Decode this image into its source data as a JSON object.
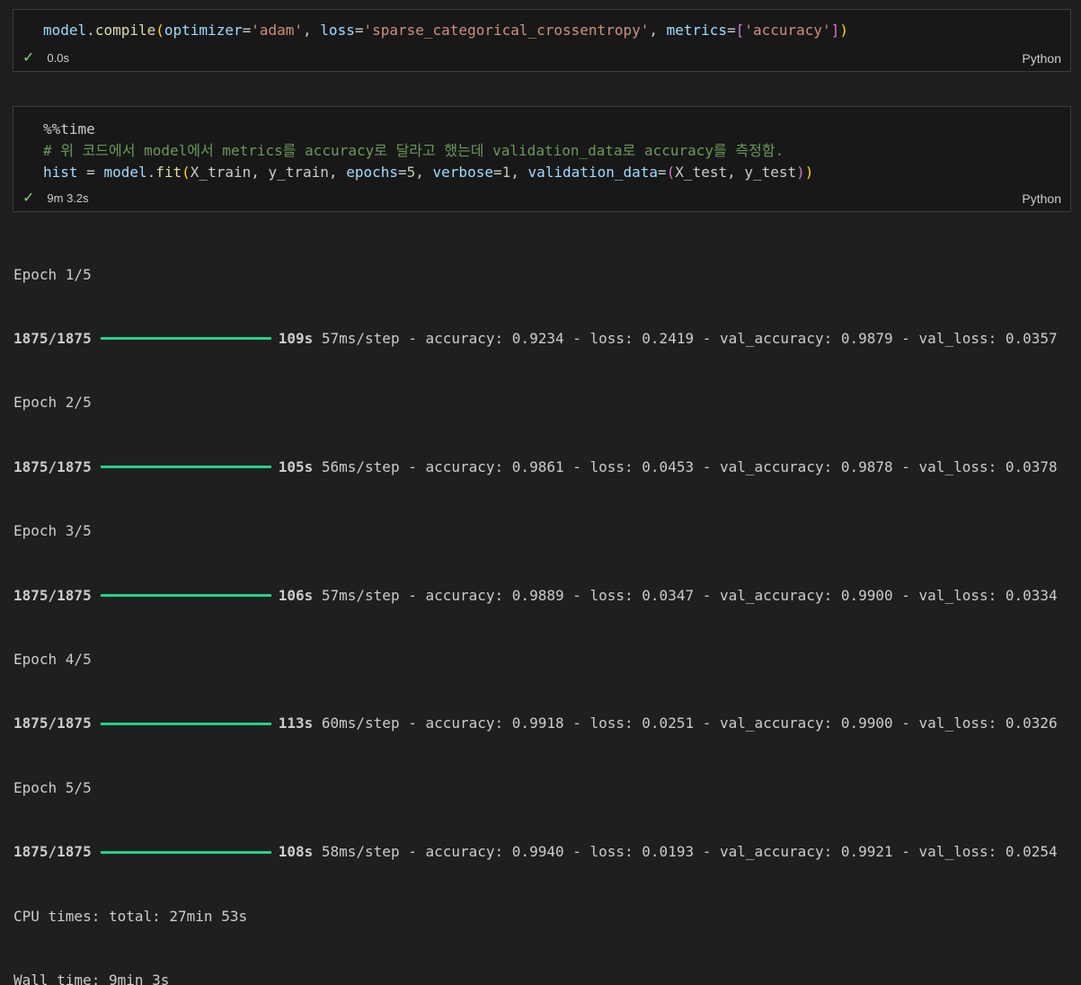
{
  "cell1": {
    "tokens": {
      "model": "model",
      "dot": ".",
      "compile": "compile",
      "open": "(",
      "optimizer": "optimizer",
      "eq1": "=",
      "adam": "'adam'",
      "comma1": ", ",
      "loss": "loss",
      "eq2": "=",
      "loss_val": "'sparse_categorical_crossentropy'",
      "comma2": ", ",
      "metrics": "metrics",
      "eq3": "=",
      "lb": "[",
      "acc": "'accuracy'",
      "rb": "]",
      "close": ")"
    },
    "time": "0.0s",
    "language": "Python"
  },
  "cell2": {
    "line1": "%%time",
    "line2": "# 위 코드에서 model에서 metrics를 accuracy로 달라고 했는데 validation_data로 accuracy를 측정함.",
    "tokens": {
      "hist": "hist",
      "assign": " = ",
      "model": "model",
      "dot": ".",
      "fit": "fit",
      "open": "(",
      "args1": "X_train, y_train, ",
      "epochs": "epochs",
      "eq1": "=",
      "five": "5",
      "comma1": ", ",
      "verbose": "verbose",
      "eq2": "=",
      "one": "1",
      "comma2": ", ",
      "vd": "validation_data",
      "eq3": "=",
      "open2": "(",
      "args2": "X_test, y_test",
      "close2": ")",
      "close": ")"
    },
    "time": "9m 3.2s",
    "language": "Python"
  },
  "output": {
    "epochs": [
      {
        "epoch": "Epoch 1/5",
        "steps": "1875/1875",
        "secs": "109s",
        "rest": "57ms/step - accuracy: 0.9234 - loss: 0.2419 - val_accuracy: 0.9879 - val_loss: 0.0357"
      },
      {
        "epoch": "Epoch 2/5",
        "steps": "1875/1875",
        "secs": "105s",
        "rest": "56ms/step - accuracy: 0.9861 - loss: 0.0453 - val_accuracy: 0.9878 - val_loss: 0.0378"
      },
      {
        "epoch": "Epoch 3/5",
        "steps": "1875/1875",
        "secs": "106s",
        "rest": "57ms/step - accuracy: 0.9889 - loss: 0.0347 - val_accuracy: 0.9900 - val_loss: 0.0334"
      },
      {
        "epoch": "Epoch 4/5",
        "steps": "1875/1875",
        "secs": "113s",
        "rest": "60ms/step - accuracy: 0.9918 - loss: 0.0251 - val_accuracy: 0.9900 - val_loss: 0.0326"
      },
      {
        "epoch": "Epoch 5/5",
        "steps": "1875/1875",
        "secs": "108s",
        "rest": "58ms/step - accuracy: 0.9940 - loss: 0.0193 - val_accuracy: 0.9921 - val_loss: 0.0254"
      }
    ],
    "cpu_times": "CPU times: total: 27min 53s",
    "wall_time": "Wall time: 9min 3s"
  },
  "colors": {
    "background": "#1f1f1f",
    "cell_background": "#181818",
    "progress_bar": "#23d18b",
    "success_check": "#89d185"
  },
  "icons": {
    "status": "check-icon"
  }
}
